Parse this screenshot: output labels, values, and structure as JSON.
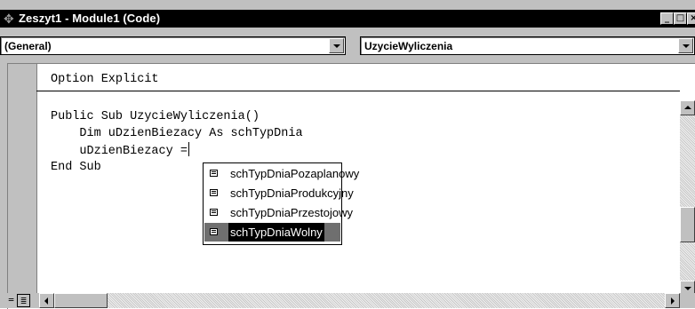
{
  "window": {
    "title": "Zeszyt1 - Module1 (Code)",
    "minimize_glyph": "_",
    "restore_glyph": "□",
    "close_glyph": "×"
  },
  "combos": {
    "object": "(General)",
    "procedure": "UzycieWyliczenia"
  },
  "code": {
    "lines": [
      "Option Explicit",
      "Public Sub UzycieWyliczenia()",
      "    Dim uDzienBiezacy As schTypDnia",
      "    uDzienBiezacy =",
      "End Sub"
    ]
  },
  "autocomplete": {
    "items": [
      "schTypDniaPozaplanowy",
      "schTypDniaProdukcyjny",
      "schTypDniaPrzestojowy",
      "schTypDniaWolny"
    ],
    "selected_index": 3
  },
  "bottom": {
    "procedure_view_glyph": "=",
    "full_module_view_glyph": "≣"
  },
  "colors": {
    "titlebar": "#000000",
    "chrome": "#c0c0c0",
    "selection": "#000000"
  },
  "icons": {
    "title": "vba-module-icon",
    "list_item": "enum-member-icon"
  }
}
